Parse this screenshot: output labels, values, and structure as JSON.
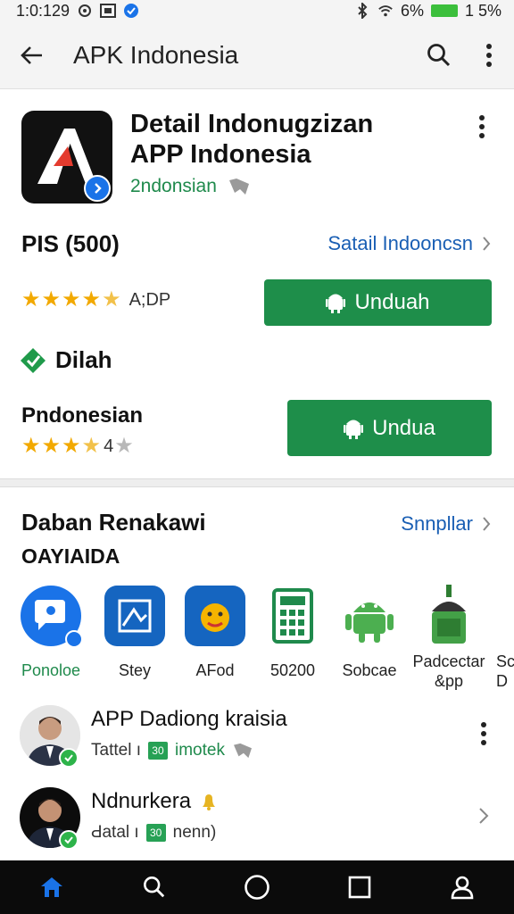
{
  "status": {
    "time": "1:0:129",
    "battery": "6%",
    "battery2": "1 5%"
  },
  "appbar": {
    "title": "APK Indonesia"
  },
  "app": {
    "title_line1": "Detail Indonugzizan",
    "title_line2": "APP Indonesia",
    "developer": "2ndonsian",
    "pis": "PIS (500)",
    "detail_link": "Satail Indooncsn",
    "rating_text": "A;DP",
    "download_label": "Unduah",
    "dilah": "Dilah",
    "pndonesian": "Pndonesian",
    "rating2_text": "4",
    "download2_label": "Undua"
  },
  "section": {
    "title": "Daban Renakawi",
    "subtitle": "OAYIAIDA",
    "link": "Snnpllar",
    "apps": [
      {
        "label": "Ponoloe",
        "color": "#1f8a4c"
      },
      {
        "label": "Stey",
        "color": "#222"
      },
      {
        "label": "AFod",
        "color": "#222"
      },
      {
        "label": "50200",
        "color": "#222"
      },
      {
        "label": "Sobcae",
        "color": "#222"
      },
      {
        "label": "Padcectar",
        "label2": "&pp",
        "color": "#222"
      },
      {
        "label": "Sc",
        "label2": "D",
        "color": "#222"
      }
    ]
  },
  "list": [
    {
      "name": "APP Dadiong kraisia",
      "meta_prefix": "Tattel ı",
      "tag": "30",
      "meta_green": "imotek"
    },
    {
      "name": "Ndnurkera",
      "meta_prefix": "Ԁatal ı",
      "tag": "30",
      "meta_green": "nenn)"
    }
  ]
}
